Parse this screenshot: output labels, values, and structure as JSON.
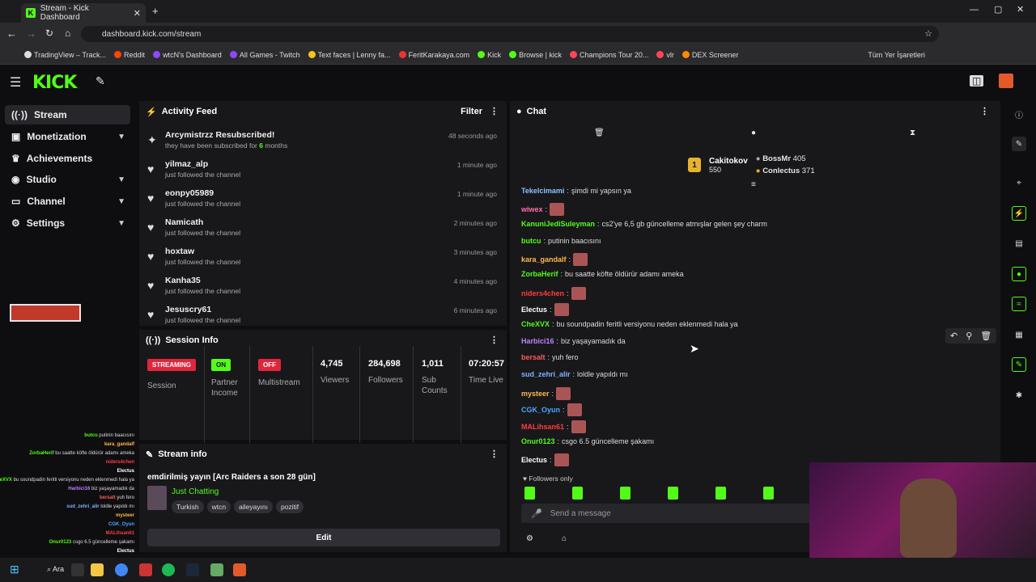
{
  "browser": {
    "tab_title": "Stream - Kick Dashboard",
    "url": "dashboard.kick.com/stream",
    "bookmarks": [
      "TradingView – Track...",
      "Reddit",
      "wtcN's Dashboard",
      "All Games - Twitch",
      "Text faces | Lenny fa...",
      "FeritKarakaya.com",
      "Kick",
      "Browse | kick",
      "Champions Tour 20...",
      "vlr",
      "DEX Screener"
    ],
    "other_bookmarks": "Tüm Yer İşaretleri"
  },
  "brand": {
    "logo": "KICK",
    "accent": "#53fc18"
  },
  "sidebar": {
    "items": [
      {
        "label": "Stream",
        "icon": "broadcast-icon"
      },
      {
        "label": "Monetization",
        "icon": "money-icon"
      },
      {
        "label": "Achievements",
        "icon": "trophy-icon"
      },
      {
        "label": "Studio",
        "icon": "studio-icon"
      },
      {
        "label": "Channel",
        "icon": "channel-icon"
      },
      {
        "label": "Settings",
        "icon": "gear-icon"
      }
    ]
  },
  "activity": {
    "title": "Activity Feed",
    "filter": "Filter",
    "items": [
      {
        "title": "Arcymistrzz Resubscribed!",
        "sub": "they have been subscribed for",
        "months": "6",
        "months_suffix": " months",
        "time": "48 seconds ago"
      },
      {
        "title": "yilmaz_alp",
        "sub": "just followed the channel",
        "time": "1 minute ago"
      },
      {
        "title": "eonpy05989",
        "sub": "just followed the channel",
        "time": "1 minute ago"
      },
      {
        "title": "Namicath",
        "sub": "just followed the channel",
        "time": "2 minutes ago"
      },
      {
        "title": "hoxtaw",
        "sub": "just followed the channel",
        "time": "3 minutes ago"
      },
      {
        "title": "Kanha35",
        "sub": "just followed the channel",
        "time": "4 minutes ago"
      },
      {
        "title": "Jesuscry61",
        "sub": "just followed the channel",
        "time": "6 minutes ago"
      }
    ]
  },
  "session": {
    "title": "Session Info",
    "streaming": "STREAMING",
    "session_label": "Session",
    "on": "ON",
    "partner_income": "Partner Income",
    "off": "OFF",
    "multistream": "Multistream",
    "stats": [
      {
        "value": "4,745",
        "label": "Viewers"
      },
      {
        "value": "284,698",
        "label": "Followers"
      },
      {
        "value": "1,011",
        "label": "Sub Counts"
      },
      {
        "value": "07:20:57",
        "label": "Time Live"
      }
    ]
  },
  "streaminfo": {
    "title": "Stream info",
    "stream_title": "emdirilmiş yayın [Arc Raiders a son 28 gün]",
    "category": "Just Chatting",
    "tags": [
      "Turkish",
      "wtcn",
      "aileyayını",
      "pozitif"
    ],
    "edit": "Edit"
  },
  "chat": {
    "title": "Chat",
    "leaders": [
      {
        "rank": "1",
        "name": "Cakitokov",
        "amount": "550"
      },
      {
        "name": "BossMr",
        "amount": "405"
      },
      {
        "name": "Conlectus",
        "amount": "371"
      }
    ],
    "messages": [
      {
        "user": "Tekelcimami",
        "color": "#8ec1ff",
        "text": "şimdi mi yapsın ya"
      },
      {
        "user": "wiwex",
        "color": "#ff6fb0",
        "text": ""
      },
      {
        "user": "KanuniJediSuleyman",
        "color": "#53fc18",
        "text": "cs2'ye 6,5 gb güncelleme atmışlar gelen şey charm"
      },
      {
        "user": "butcu",
        "color": "#53fc18",
        "text": "putinin baacısını"
      },
      {
        "user": "kara_gandalf",
        "color": "#ffb84d",
        "text": ""
      },
      {
        "user": "ZorbaHerif",
        "color": "#53fc18",
        "text": "bu saatte köfte öldürür adamı ameka"
      },
      {
        "user": "niders4chen",
        "color": "#ff3c3c",
        "text": ""
      },
      {
        "user": "Electus",
        "color": "#fff",
        "text": ""
      },
      {
        "user": "CheXVX",
        "color": "#53fc18",
        "text": "bu soundpadin feritli versiyonu neden eklenmedi hala ya"
      },
      {
        "user": "Harbici16",
        "color": "#c080ff",
        "text": "biz yaşayamadık da"
      },
      {
        "user": "bersalt",
        "color": "#ff5a5a",
        "text": "yuh fero"
      },
      {
        "user": "sud_zehri_alir",
        "color": "#7fb2ff",
        "text": "loldle yapıldı mı"
      },
      {
        "user": "mysteer",
        "color": "#ffb84d",
        "text": ""
      },
      {
        "user": "CGK_Oyun",
        "color": "#4da6ff",
        "text": ""
      },
      {
        "user": "MALihsan61",
        "color": "#ff3c3c",
        "text": ""
      },
      {
        "user": "Onur0123",
        "color": "#53fc18",
        "text": "csgo 6.5 güncelleme şakamı"
      },
      {
        "user": "Electus",
        "color": "#fff",
        "text": ""
      }
    ],
    "followers_only": "Followers only",
    "placeholder": "Send a message"
  },
  "taskbar": {
    "search": "Ara"
  }
}
